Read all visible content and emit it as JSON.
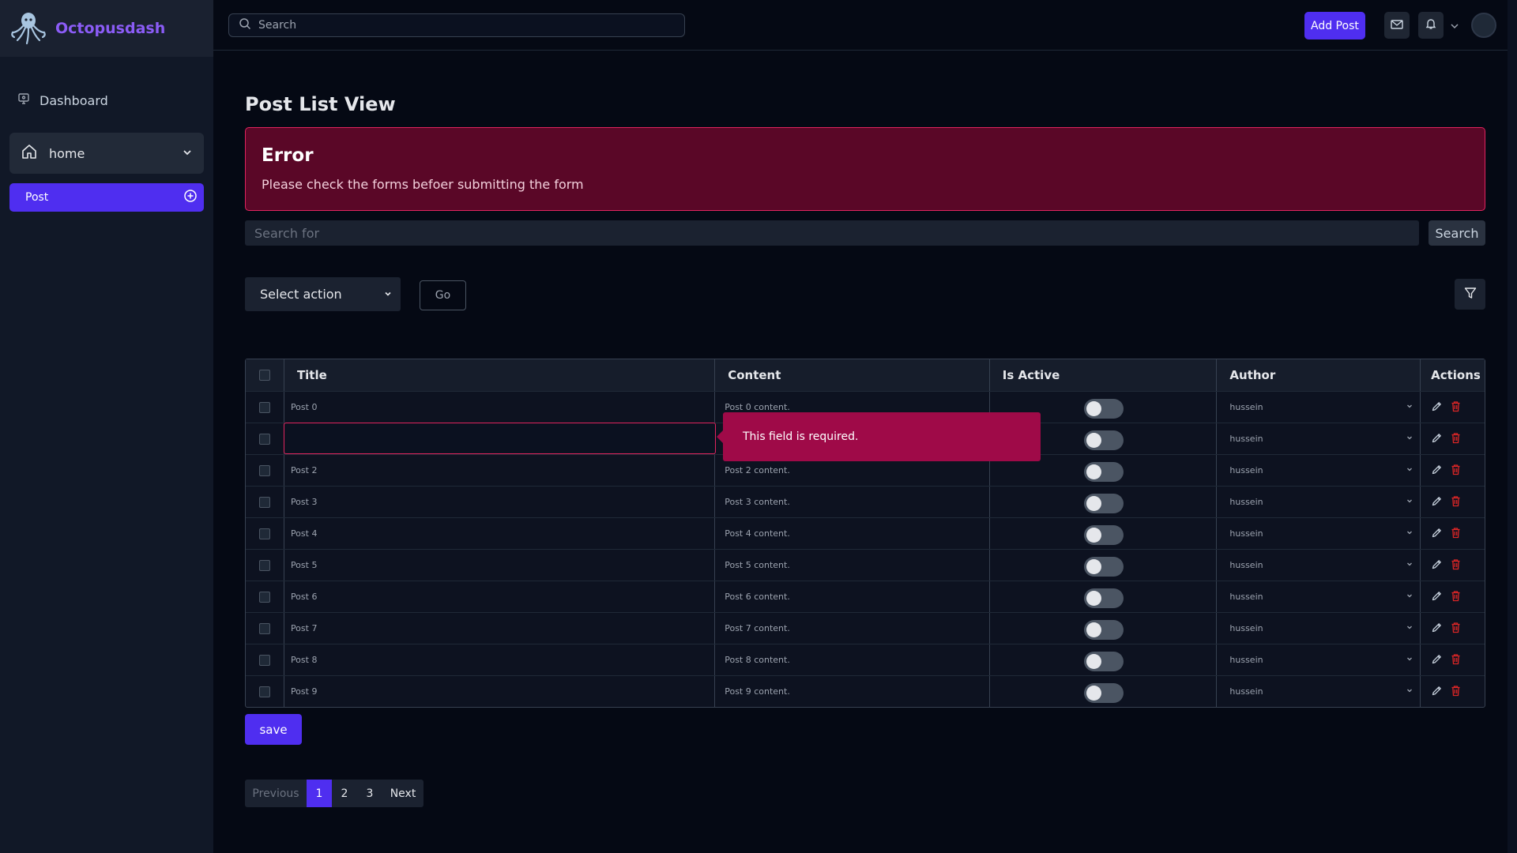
{
  "app": {
    "name": "Octopusdash"
  },
  "sidebar": {
    "dashboard_label": "Dashboard",
    "home_label": "home",
    "post_label": "Post"
  },
  "topbar": {
    "search_placeholder": "Search",
    "add_post_label": "Add Post"
  },
  "page": {
    "title_bold": "Post",
    "title_rest": " List View"
  },
  "alert": {
    "title": "Error",
    "message": "Please check the forms befoer submitting the form"
  },
  "search": {
    "placeholder": "Search for",
    "button_label": "Search"
  },
  "actions": {
    "select_label": "Select action",
    "go_label": "Go"
  },
  "table": {
    "headers": {
      "title": "Title",
      "content": "Content",
      "is_active": "Is Active",
      "author": "Author",
      "actions": "Actions"
    },
    "rows": [
      {
        "title": "Post 0",
        "content": "Post 0 content.",
        "author": "hussein",
        "active": false
      },
      {
        "title": "",
        "content": "",
        "author": "hussein",
        "active": false
      },
      {
        "title": "Post 2",
        "content": "Post 2 content.",
        "author": "hussein",
        "active": false
      },
      {
        "title": "Post 3",
        "content": "Post 3 content.",
        "author": "hussein",
        "active": false
      },
      {
        "title": "Post 4",
        "content": "Post 4 content.",
        "author": "hussein",
        "active": false
      },
      {
        "title": "Post 5",
        "content": "Post 5 content.",
        "author": "hussein",
        "active": false
      },
      {
        "title": "Post 6",
        "content": "Post 6 content.",
        "author": "hussein",
        "active": false
      },
      {
        "title": "Post 7",
        "content": "Post 7 content.",
        "author": "hussein",
        "active": false
      },
      {
        "title": "Post 8",
        "content": "Post 8 content.",
        "author": "hussein",
        "active": false
      },
      {
        "title": "Post 9",
        "content": "Post 9 content.",
        "author": "hussein",
        "active": false
      }
    ],
    "validation_message": "This field is required."
  },
  "save_label": "save",
  "pagination": {
    "previous": "Previous",
    "pages": [
      "1",
      "2",
      "3"
    ],
    "current": "1",
    "next": "Next"
  },
  "colors": {
    "accent": "#4f2ef0",
    "brand": "#8b5cf6",
    "error_bg": "#5a0727",
    "error_border": "#e0245e",
    "tooltip_bg": "#9f0a48",
    "delete_icon": "#dc2626"
  },
  "icons": {
    "brand": "octopus-logo",
    "dashboard": "monitor-icon",
    "home": "home-icon",
    "post_add": "plus-circle-icon",
    "search": "search-icon",
    "mail": "mail-icon",
    "bell": "bell-icon",
    "filter": "filter-icon",
    "edit": "pencil-icon",
    "delete": "trash-icon"
  }
}
